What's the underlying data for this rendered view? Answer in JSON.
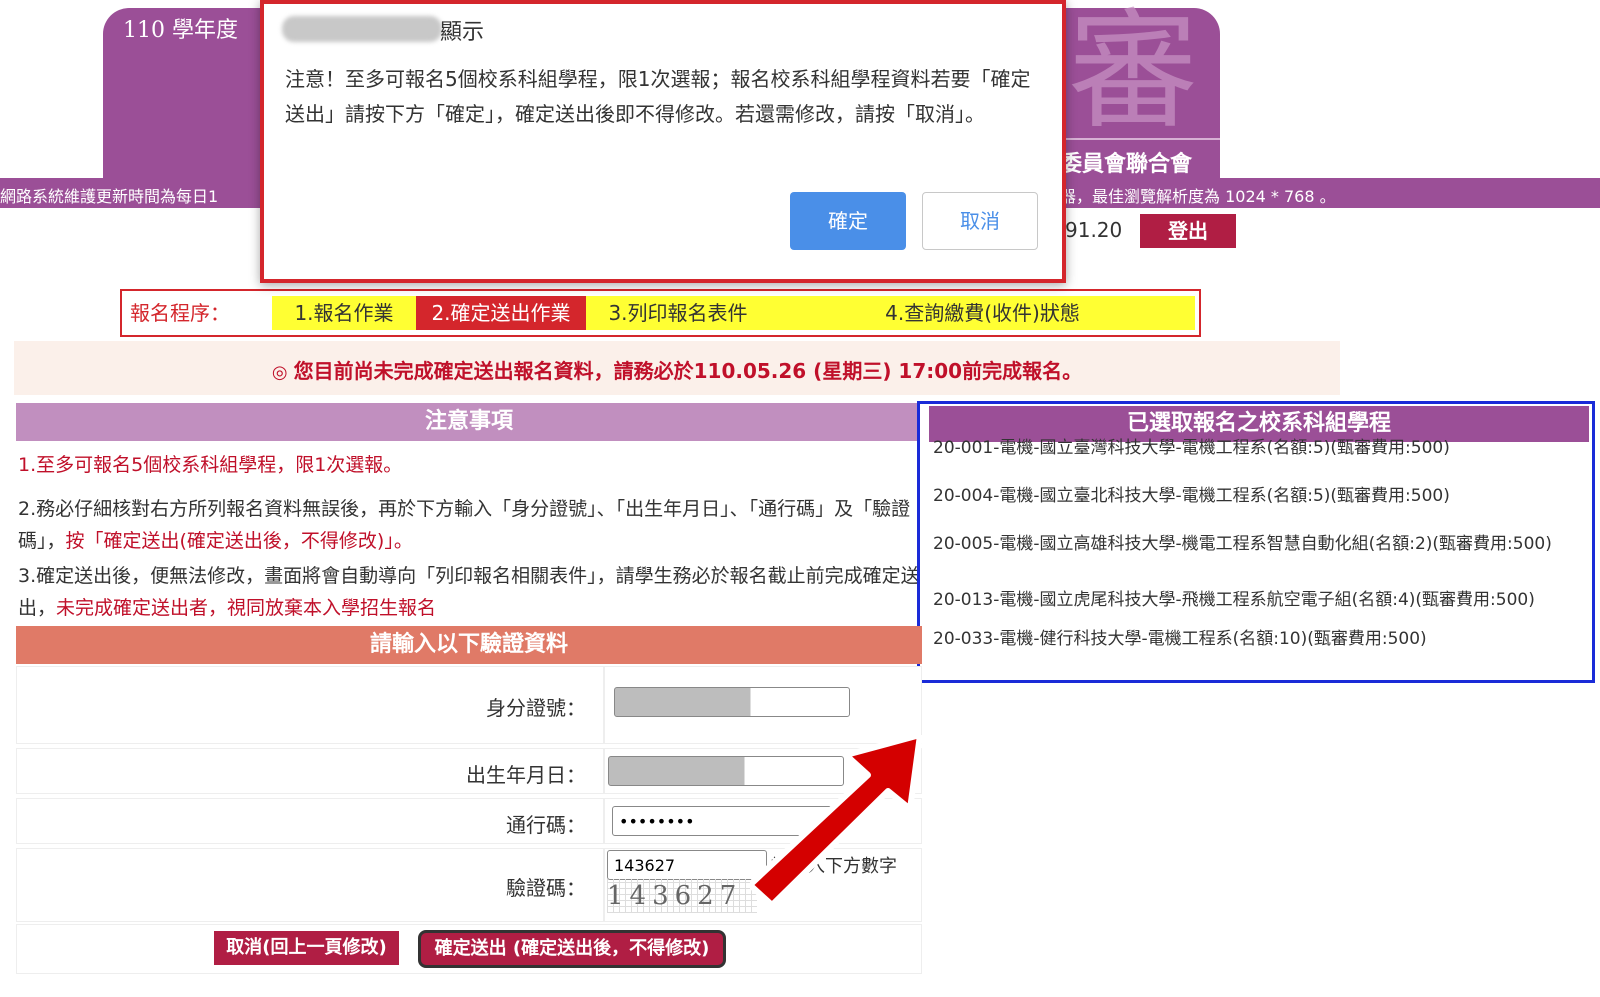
{
  "header": {
    "year_title": "110 學年度",
    "watermark_char": "審",
    "org_name_partial": "委員會聯合會",
    "notice_left": "網路系統維護更新時間為每日1",
    "notice_right": "器，最佳瀏覽解析度為 1024 * 768 。",
    "user_ip_partial": "91.20",
    "logout_label": "登出"
  },
  "steps": {
    "label": "報名程序：",
    "items": [
      "1.報名作業",
      "2.確定送出作業",
      "3.列印報名表件",
      "4.查詢繳費(收件)狀態"
    ],
    "active_index": 1
  },
  "deadline": {
    "bullet": "◎",
    "text": "您目前尚未完成確定送出報名資料，請務必於110.05.26 (星期三) 17:00前完成報名。"
  },
  "notes": {
    "header": "注意事項",
    "note1": "1.至多可報名5個校系科組學程，限1次選報。",
    "note2_a": "2.務必仔細核對右方所列報名資料無誤後，再於下方輸入「身分證號」、「出生年月日」、「通行碼」及「驗證碼」，",
    "note2_b": "按「確定送出(確定送出後，不得修改)」。",
    "note3_a": "3.確定送出後，便無法修改，畫面將會自動導向「列印報名相關表件」，請學生務必於報名截止前完成確定送出，",
    "note3_b": "未完成確定送出者，視同放棄本入學招生報名"
  },
  "selected": {
    "header": "已選取報名之校系科組學程",
    "programs": [
      "20-001-電機-國立臺灣科技大學-電機工程系(名額:5)(甄審費用:500)",
      "20-004-電機-國立臺北科技大學-電機工程系(名額:5)(甄審費用:500)",
      "20-005-電機-國立高雄科技大學-機電工程系智慧自動化組(名額:2)(甄審費用:500)",
      "20-013-電機-國立虎尾科技大學-飛機工程系航空電子組(名額:4)(甄審費用:500)",
      "20-033-電機-健行科技大學-電機工程系(名額:10)(甄審費用:500)"
    ]
  },
  "form": {
    "header": "請輸入以下驗證資料",
    "id_label": "身分證號：",
    "birth_label": "出生年月日：",
    "pass_label": "通行碼：",
    "pass_value": "••••••••",
    "captcha_label": "驗證碼：",
    "captcha_value": "143627",
    "captcha_image_text": "143627",
    "captcha_hint": "請輸入下方數字",
    "cancel_label": "取消(回上一頁修改)",
    "submit_label": "確定送出 (確定送出後，不得修改)"
  },
  "modal": {
    "title": "顯示",
    "message": "注意！至多可報名5個校系科組學程，限1次選報；報名校系科組學程資料若要「確定送出」請按下方「確定」，確定送出後即不得修改。若還需修改，請按「取消」。",
    "ok_label": "確定",
    "cancel_label": "取消"
  },
  "colors": {
    "brand_purple": "#9b4f97",
    "alert_red": "#d4262c",
    "button_red": "#b01e44",
    "highlight_blue": "#1a2bd8",
    "dialog_blue": "#4a8fe8"
  },
  "icons": {
    "arrow": "arrow-up-right-icon"
  }
}
